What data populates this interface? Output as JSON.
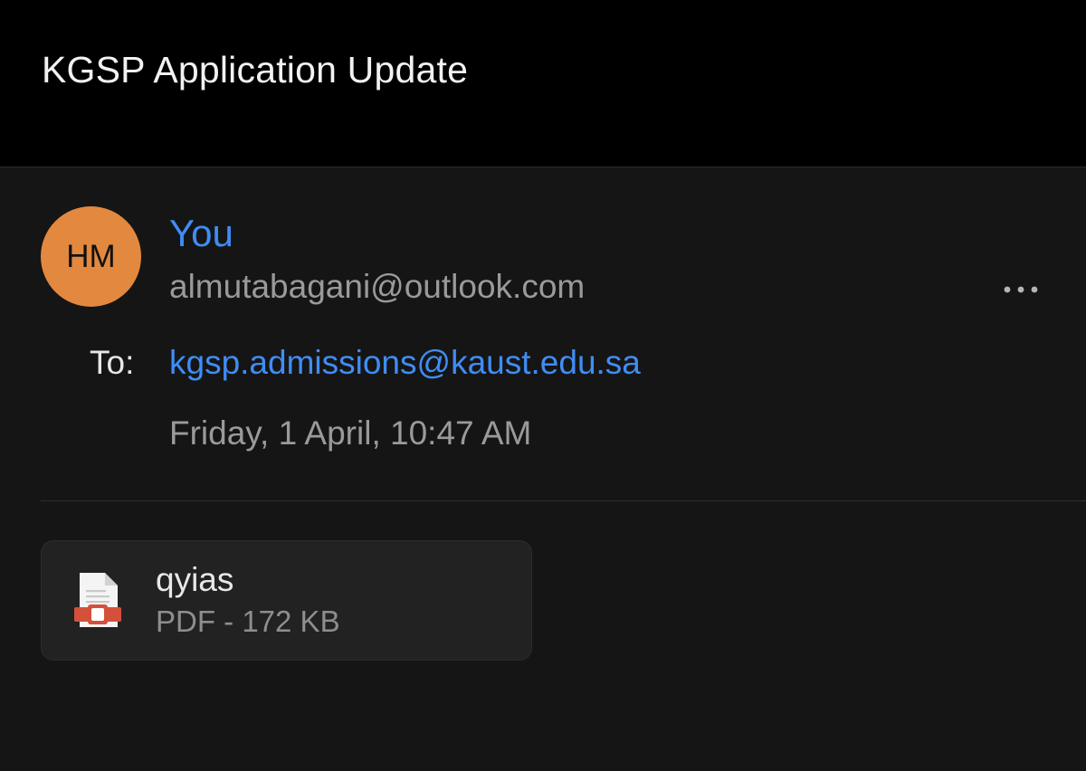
{
  "header": {
    "subject": "KGSP Application Update"
  },
  "message": {
    "avatar_initials": "HM",
    "avatar_color": "#e3883f",
    "sender_name": "You",
    "sender_email": "almutabagani@outlook.com",
    "to_label": "To:",
    "to_address": "kgsp.admissions@kaust.edu.sa",
    "date": "Friday, 1 April, 10:47 AM",
    "more_icon": "more-horizontal-icon",
    "link_color": "#3f8df5"
  },
  "attachment": {
    "name": "qyias",
    "meta": "PDF - 172 KB",
    "icon": "pdf-file-icon"
  }
}
